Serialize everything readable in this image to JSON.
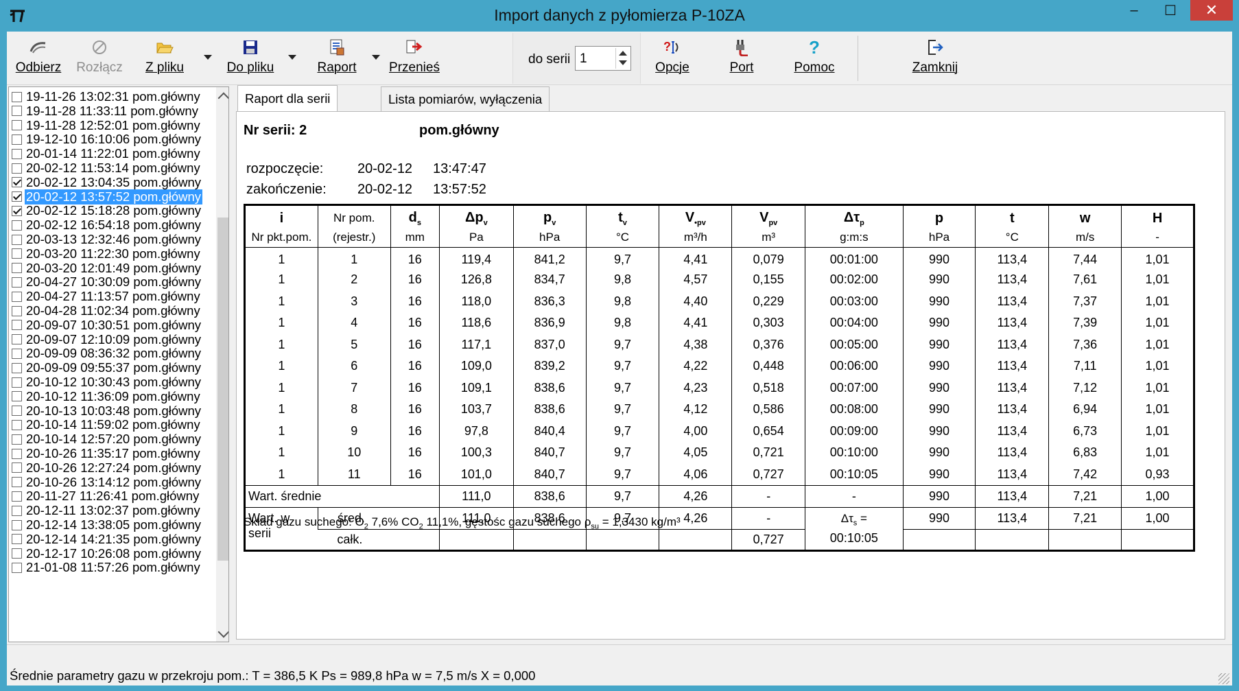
{
  "window": {
    "title": "Import danych z pyłomierza P-10ZA",
    "minimize_glyph": "–",
    "maximize_glyph": "☐",
    "close_glyph": "✕"
  },
  "toolbar": {
    "odbierz": "Odbierz",
    "rozlacz": "Rozłącz",
    "z_pliku": "Z pliku",
    "do_pliku": "Do pliku",
    "raport": "Raport",
    "przenies": "Przenieś",
    "do_serii_label": "do serii",
    "do_serii_value": "1",
    "opcje": "Opcje",
    "port": "Port",
    "pomoc": "Pomoc",
    "zamknij": "Zamknij"
  },
  "list": {
    "items": [
      {
        "text": "19-11-26 13:02:31 pom.główny",
        "checked": false
      },
      {
        "text": "19-11-28 11:33:11 pom.główny",
        "checked": false
      },
      {
        "text": "19-11-28 12:52:01 pom.główny",
        "checked": false
      },
      {
        "text": "19-12-10 16:10:06 pom.główny",
        "checked": false
      },
      {
        "text": "20-01-14 11:22:01 pom.główny",
        "checked": false
      },
      {
        "text": "20-02-12 11:53:14 pom.główny",
        "checked": false
      },
      {
        "text": "20-02-12 13:04:35 pom.główny",
        "checked": true
      },
      {
        "text": "20-02-12 13:57:52 pom.główny",
        "checked": true,
        "selected": true
      },
      {
        "text": "20-02-12 15:18:28 pom.główny",
        "checked": true
      },
      {
        "text": "20-02-12 16:54:18 pom.główny",
        "checked": false
      },
      {
        "text": "20-03-13 12:32:46 pom.główny",
        "checked": false
      },
      {
        "text": "20-03-20 11:22:30 pom.główny",
        "checked": false
      },
      {
        "text": "20-03-20 12:01:49 pom.główny",
        "checked": false
      },
      {
        "text": "20-04-27 10:30:09 pom.główny",
        "checked": false
      },
      {
        "text": "20-04-27 11:13:57 pom.główny",
        "checked": false
      },
      {
        "text": "20-04-28 11:02:34 pom.główny",
        "checked": false
      },
      {
        "text": "20-09-07 10:30:51 pom.główny",
        "checked": false
      },
      {
        "text": "20-09-07 12:10:09 pom.główny",
        "checked": false
      },
      {
        "text": "20-09-09 08:36:32 pom.główny",
        "checked": false
      },
      {
        "text": "20-09-09 09:55:37 pom.główny",
        "checked": false
      },
      {
        "text": "20-10-12 10:30:43 pom.główny",
        "checked": false
      },
      {
        "text": "20-10-12 11:36:09 pom.główny",
        "checked": false
      },
      {
        "text": "20-10-13 10:03:48 pom.główny",
        "checked": false
      },
      {
        "text": "20-10-14 11:59:02 pom.główny",
        "checked": false
      },
      {
        "text": "20-10-14 12:57:20 pom.główny",
        "checked": false
      },
      {
        "text": "20-10-26 11:35:17 pom.główny",
        "checked": false
      },
      {
        "text": "20-10-26 12:27:24 pom.główny",
        "checked": false
      },
      {
        "text": "20-10-26 13:14:12 pom.główny",
        "checked": false
      },
      {
        "text": "20-11-27 11:26:41 pom.główny",
        "checked": false
      },
      {
        "text": "20-12-11 13:02:37 pom.główny",
        "checked": false
      },
      {
        "text": "20-12-14 13:38:05 pom.główny",
        "checked": false
      },
      {
        "text": "20-12-14 14:21:35 pom.główny",
        "checked": false
      },
      {
        "text": "20-12-17 10:26:08 pom.główny",
        "checked": false
      },
      {
        "text": "21-01-08 11:57:26 pom.główny",
        "checked": false
      }
    ]
  },
  "tabs": {
    "raport": "Raport dla serii",
    "lista": "Lista pomiarów, wyłączenia"
  },
  "report": {
    "nr_serii": "Nr serii: 2",
    "point_name": "pom.główny",
    "start_label": "rozpoczęcie:",
    "start_date": "20-02-12",
    "start_time": "13:47:47",
    "end_label": "zakończenie:",
    "end_date": "20-02-12",
    "end_time": "13:57:52",
    "headers": {
      "i": "i",
      "nrpom": "Nr pom.",
      "ds": "d",
      "ds_sub": "s",
      "dp": "Δp",
      "dp_sub": "v",
      "pv": "p",
      "pv_sub": "v",
      "tv": "t",
      "tv_sub": "v",
      "vdot": "V",
      "vdot_sub": "•pv",
      "vpv": "V",
      "vpv_sub": "pv",
      "dtau": "Δτ",
      "dtau_sub": "p",
      "p": "p",
      "t": "t",
      "w": "w",
      "h": "H"
    },
    "units": {
      "i": "Nr pkt.pom.",
      "nrpom": "(rejestr.)",
      "ds": "mm",
      "dp": "Pa",
      "pv": "hPa",
      "tv": "°C",
      "vdot": "m³/h",
      "vpv": "m³",
      "dtau": "g:m:s",
      "p": "hPa",
      "t": "°C",
      "w": "m/s",
      "h": "-"
    },
    "rows": [
      [
        "1",
        "1",
        "16",
        "119,4",
        "841,2",
        "9,7",
        "4,41",
        "0,079",
        "00:01:00",
        "990",
        "113,4",
        "7,44",
        "1,01"
      ],
      [
        "1",
        "2",
        "16",
        "126,8",
        "834,7",
        "9,8",
        "4,57",
        "0,155",
        "00:02:00",
        "990",
        "113,4",
        "7,61",
        "1,01"
      ],
      [
        "1",
        "3",
        "16",
        "118,0",
        "836,3",
        "9,8",
        "4,40",
        "0,229",
        "00:03:00",
        "990",
        "113,4",
        "7,37",
        "1,01"
      ],
      [
        "1",
        "4",
        "16",
        "118,6",
        "836,9",
        "9,8",
        "4,41",
        "0,303",
        "00:04:00",
        "990",
        "113,4",
        "7,39",
        "1,01"
      ],
      [
        "1",
        "5",
        "16",
        "117,1",
        "837,0",
        "9,7",
        "4,38",
        "0,376",
        "00:05:00",
        "990",
        "113,4",
        "7,36",
        "1,01"
      ],
      [
        "1",
        "6",
        "16",
        "109,0",
        "839,2",
        "9,7",
        "4,22",
        "0,448",
        "00:06:00",
        "990",
        "113,4",
        "7,11",
        "1,01"
      ],
      [
        "1",
        "7",
        "16",
        "109,1",
        "838,6",
        "9,7",
        "4,23",
        "0,518",
        "00:07:00",
        "990",
        "113,4",
        "7,12",
        "1,01"
      ],
      [
        "1",
        "8",
        "16",
        "103,7",
        "838,6",
        "9,7",
        "4,12",
        "0,586",
        "00:08:00",
        "990",
        "113,4",
        "6,94",
        "1,01"
      ],
      [
        "1",
        "9",
        "16",
        "97,8",
        "840,4",
        "9,7",
        "4,00",
        "0,654",
        "00:09:00",
        "990",
        "113,4",
        "6,73",
        "1,01"
      ],
      [
        "1",
        "10",
        "16",
        "100,3",
        "840,7",
        "9,7",
        "4,05",
        "0,721",
        "00:10:00",
        "990",
        "113,4",
        "6,83",
        "1,01"
      ],
      [
        "1",
        "11",
        "16",
        "101,0",
        "840,7",
        "9,7",
        "4,06",
        "0,727",
        "00:10:05",
        "990",
        "113,4",
        "7,42",
        "0,93"
      ]
    ],
    "avg": {
      "label": "Wart. średnie",
      "values": [
        "111,0",
        "838,6",
        "9,7",
        "4,26",
        "-",
        "-",
        "990",
        "113,4",
        "7,21",
        "1,00"
      ]
    },
    "series": {
      "label_top": "Wart. w",
      "label_bottom": "serii",
      "sred_label": "śred.",
      "calk_label": "całk.",
      "sred_values": [
        "111,0",
        "838,6",
        "9,7",
        "4,26",
        "-"
      ],
      "dts_label": "Δτ",
      "dts_sub": "s",
      "dts_eq": " =",
      "dts_value": "00:10:05",
      "sred_tail": [
        "990",
        "113,4",
        "7,21",
        "1,00"
      ],
      "calk_vpv": "0,727"
    },
    "footer": {
      "lead": "Skład gazu suchego: O",
      "o2_sub": "2",
      "o2_val": "  7,6% CO",
      "co2_sub": "2",
      "co2_val": " 11,1%,  gęstośc gazu suchego  ρ",
      "rho_sub": "su",
      "rho_val": " =  1,3430 kg/m³"
    }
  },
  "status": {
    "text": "Średnie parametry gazu w  przekroju pom.:  T = 386,5 K  Ps = 989,8 hPa  w = 7,5 m/s  X = 0,000"
  }
}
